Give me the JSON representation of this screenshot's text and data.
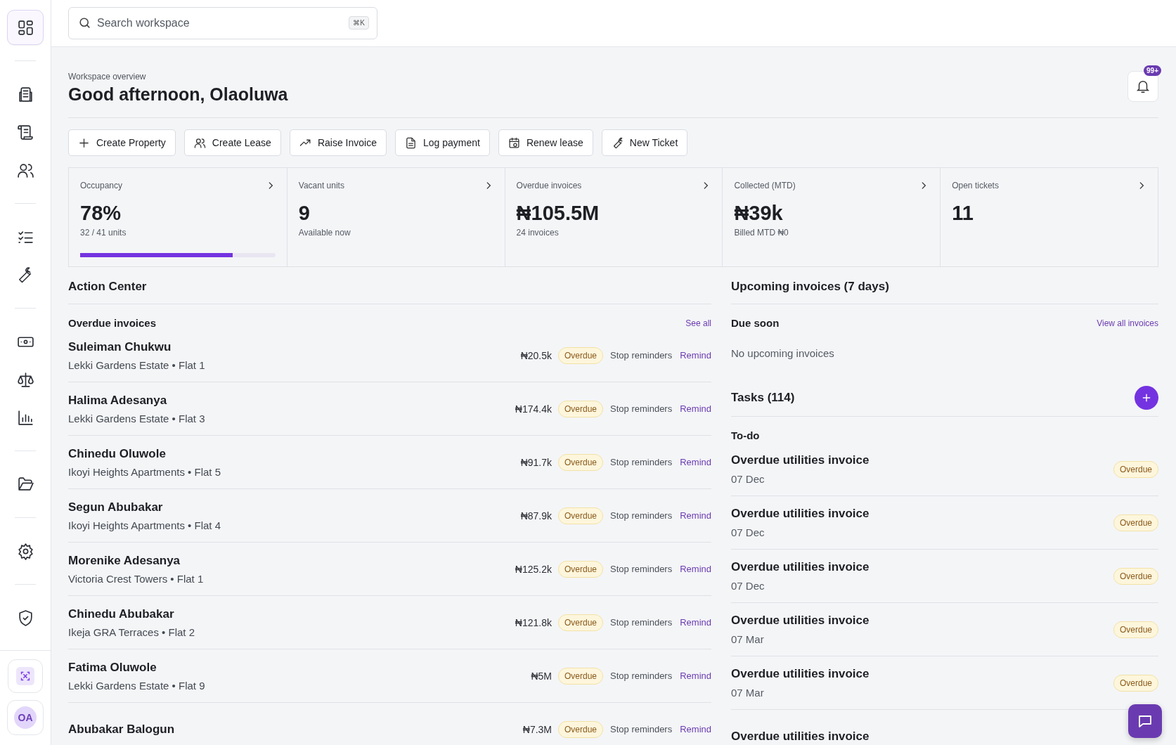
{
  "sidebar": {
    "groups": [
      {
        "items": [
          {
            "selected": true
          }
        ]
      },
      {
        "items": [
          {
            "selected": false
          },
          {
            "selected": false
          },
          {
            "selected": false
          }
        ]
      },
      {
        "items": [
          {
            "selected": false
          },
          {
            "selected": false
          }
        ]
      },
      {
        "items": [
          {
            "selected": false
          },
          {
            "selected": false
          },
          {
            "selected": false
          }
        ]
      },
      {
        "items": [
          {
            "selected": false
          }
        ]
      },
      {
        "items": [
          {
            "selected": false
          }
        ]
      },
      {
        "items": [
          {
            "selected": false
          }
        ]
      }
    ],
    "avatar": "OA"
  },
  "search": {
    "placeholder": "Search workspace",
    "shortcut": "⌘K"
  },
  "overview": {
    "eyebrow": "Workspace overview",
    "title": "Good afternoon, Olaoluwa",
    "notifications": "99+"
  },
  "actions": [
    "Create Property",
    "Create Lease",
    "Raise Invoice",
    "Log payment",
    "Renew lease",
    "New Ticket"
  ],
  "stats": [
    {
      "label": "Occupancy",
      "value": "78%",
      "sub": "32 / 41 units",
      "level": 0.78
    },
    {
      "label": "Vacant units",
      "value": "9",
      "sub": "Available now"
    },
    {
      "label": "Overdue invoices",
      "value": "₦105.5M",
      "sub": "24 invoices"
    },
    {
      "label": "Collected (MTD)",
      "value": "₦39k",
      "sub": "Billed MTD ₦0"
    },
    {
      "label": "Open tickets",
      "value": "11"
    }
  ],
  "action_center": {
    "title": "Action Center",
    "section": "Overdue invoices",
    "link": "See all",
    "rows": [
      {
        "name": "Suleiman Chukwu",
        "place": "Lekki Gardens Estate • Flat 1",
        "amount": "₦20.5k",
        "status": "Overdue",
        "stop": "Stop reminders",
        "remind": "Remind"
      },
      {
        "name": "Halima Adesanya",
        "place": "Lekki Gardens Estate • Flat 3",
        "amount": "₦174.4k",
        "status": "Overdue",
        "stop": "Stop reminders",
        "remind": "Remind"
      },
      {
        "name": "Chinedu Oluwole",
        "place": "Ikoyi Heights Apartments • Flat 5",
        "amount": "₦91.7k",
        "status": "Overdue",
        "stop": "Stop reminders",
        "remind": "Remind"
      },
      {
        "name": "Segun Abubakar",
        "place": "Ikoyi Heights Apartments • Flat 4",
        "amount": "₦87.9k",
        "status": "Overdue",
        "stop": "Stop reminders",
        "remind": "Remind"
      },
      {
        "name": "Morenike Adesanya",
        "place": "Victoria Crest Towers • Flat 1",
        "amount": "₦125.2k",
        "status": "Overdue",
        "stop": "Stop reminders",
        "remind": "Remind"
      },
      {
        "name": "Chinedu Abubakar",
        "place": "Ikeja GRA Terraces • Flat 2",
        "amount": "₦121.8k",
        "status": "Overdue",
        "stop": "Stop reminders",
        "remind": "Remind"
      },
      {
        "name": "Fatima Oluwole",
        "place": "Lekki Gardens Estate • Flat 9",
        "amount": "₦5M",
        "status": "Overdue",
        "stop": "Stop reminders",
        "remind": "Remind"
      },
      {
        "name": "Abubakar Balogun",
        "amount": "₦7.3M",
        "status": "Overdue",
        "stop": "Stop reminders",
        "remind": "Remind"
      }
    ]
  },
  "upcoming": {
    "title": "Upcoming invoices (7 days)",
    "section": "Due soon",
    "link": "View all invoices",
    "empty": "No upcoming invoices"
  },
  "tasks": {
    "title": "Tasks (114)",
    "section": "To-do",
    "items": [
      {
        "title": "Overdue utilities invoice",
        "date": "07 Dec",
        "status": "Overdue"
      },
      {
        "title": "Overdue utilities invoice",
        "date": "07 Dec",
        "status": "Overdue"
      },
      {
        "title": "Overdue utilities invoice",
        "date": "07 Dec",
        "status": "Overdue"
      },
      {
        "title": "Overdue utilities invoice",
        "date": "07 Mar",
        "status": "Overdue"
      },
      {
        "title": "Overdue utilities invoice",
        "date": "07 Mar",
        "status": "Overdue"
      },
      {
        "title": "Overdue utilities invoice"
      }
    ]
  }
}
